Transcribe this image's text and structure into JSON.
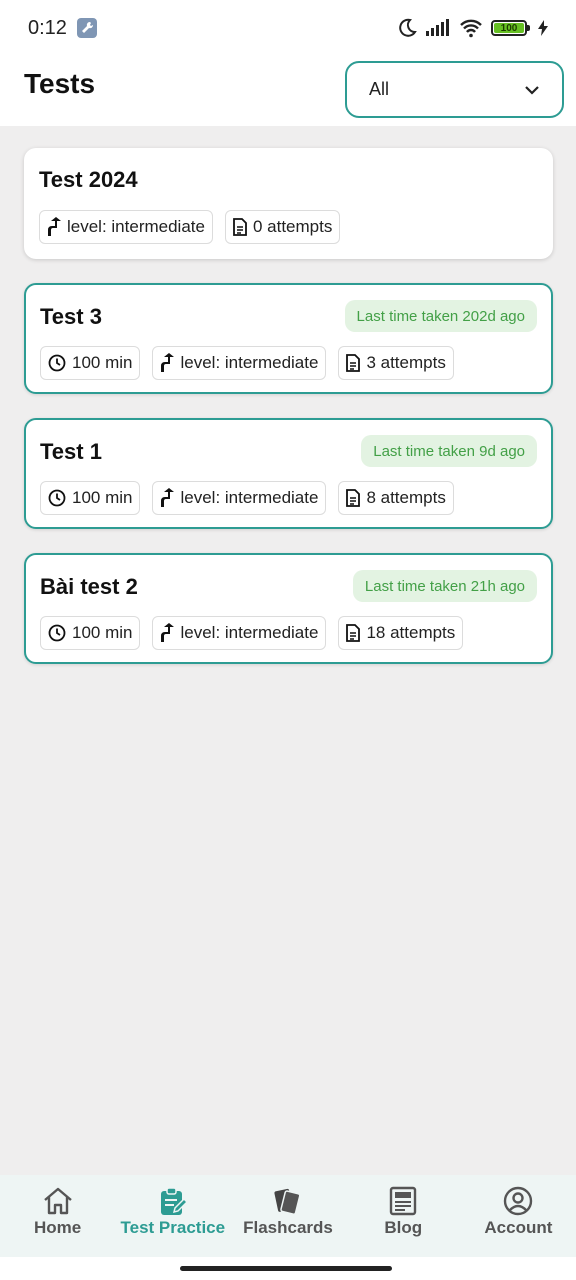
{
  "status_bar": {
    "time": "0:12",
    "battery_level": "100",
    "icons": [
      "wrench-icon",
      "moon-icon",
      "signal-icon",
      "wifi-icon",
      "battery-icon",
      "charging-icon"
    ]
  },
  "header": {
    "title": "Tests",
    "filter": {
      "value": "All",
      "icon": "chevron-down-icon",
      "accent_color": "#2d9c93"
    }
  },
  "tests": [
    {
      "title": "Test 2024",
      "last_taken": "",
      "duration": "",
      "level": "level: intermediate",
      "attempts": "0 attempts"
    },
    {
      "title": "Test 3",
      "last_taken": "Last time taken 202d ago",
      "duration": "100 min",
      "level": "level: intermediate",
      "attempts": "3 attempts"
    },
    {
      "title": "Test 1",
      "last_taken": "Last time taken 9d ago",
      "duration": "100 min",
      "level": "level: intermediate",
      "attempts": "8 attempts"
    },
    {
      "title": "Bài test 2",
      "last_taken": "Last time taken 21h ago",
      "duration": "100 min",
      "level": "level: intermediate",
      "attempts": "18 attempts"
    }
  ],
  "nav": {
    "items": [
      {
        "label": "Home",
        "icon": "home-icon",
        "active": false
      },
      {
        "label": "Test Practice",
        "icon": "clipboard-edit-icon",
        "active": true
      },
      {
        "label": "Flashcards",
        "icon": "cards-icon",
        "active": false
      },
      {
        "label": "Blog",
        "icon": "newspaper-icon",
        "active": false
      },
      {
        "label": "Account",
        "icon": "account-circle-icon",
        "active": false
      }
    ],
    "active_color": "#2d9c93"
  }
}
